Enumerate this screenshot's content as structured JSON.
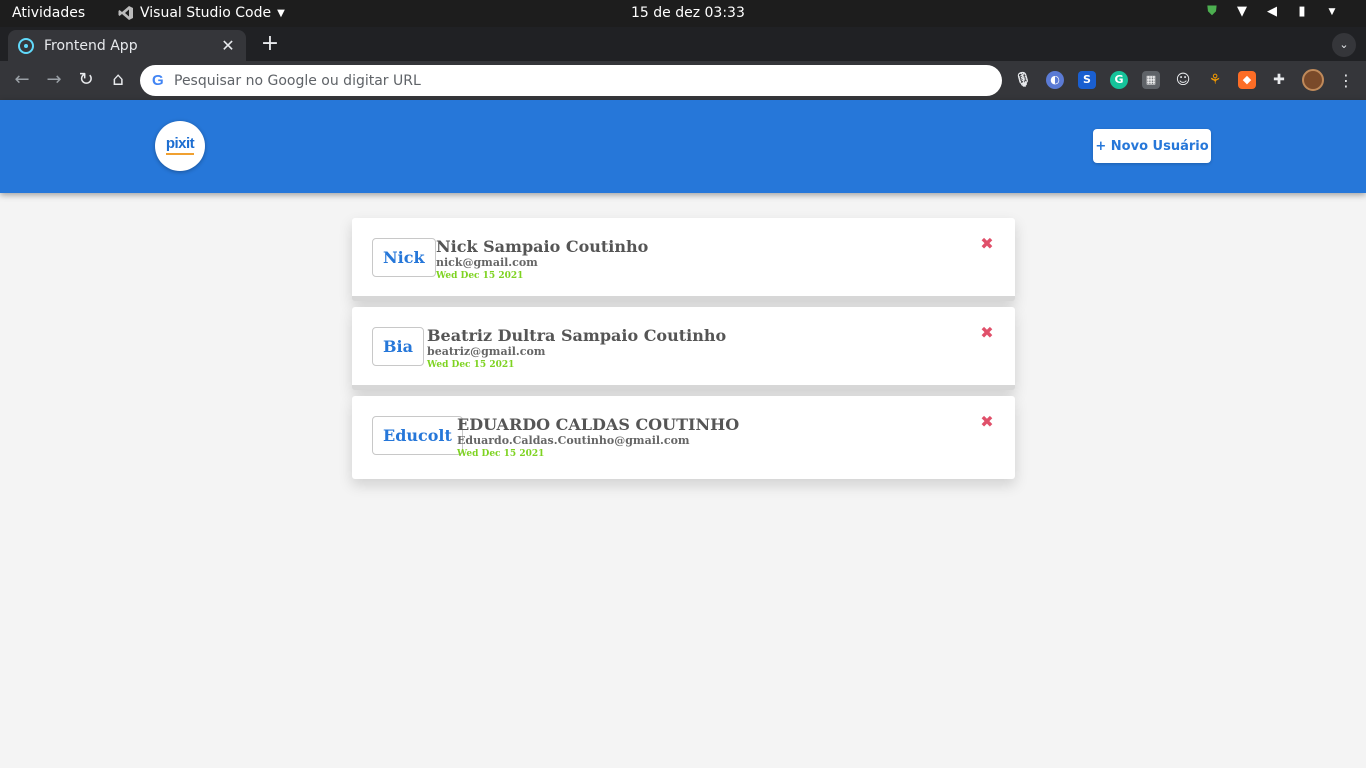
{
  "system_bar": {
    "activities": "Atividades",
    "app_name": "Visual Studio Code",
    "clock": "15 de dez  03:33"
  },
  "browser": {
    "tab_title": "Frontend App",
    "omnibox_placeholder": "Pesquisar no Google ou digitar URL"
  },
  "app": {
    "logo_text": "pixit",
    "new_user_label": "+ Novo Usuário",
    "users": [
      {
        "nick": "Nick",
        "name": "Nick Sampaio Coutinho",
        "email": "nick@gmail.com",
        "date": "Wed Dec 15 2021"
      },
      {
        "nick": "Bia",
        "name": "Beatriz Dultra Sampaio Coutinho",
        "email": "beatriz@gmail.com",
        "date": "Wed Dec 15 2021"
      },
      {
        "nick": "Educolt",
        "name": "EDUARDO CALDAS COUTINHO",
        "email": "Eduardo.Caldas.Coutinho@gmail.com",
        "date": "Wed Dec 15 2021"
      }
    ],
    "delete_icon": "✖"
  },
  "colors": {
    "header_blue": "#2677d9",
    "date_green": "#7ed321",
    "delete_red": "#e0506a"
  }
}
